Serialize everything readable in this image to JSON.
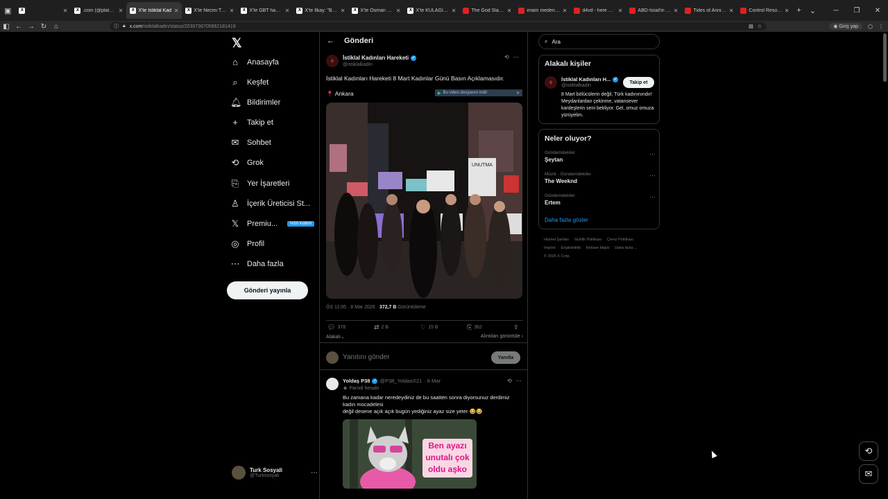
{
  "browser": {
    "tabs": [
      {
        "label": "",
        "icon": "x"
      },
      {
        "label": ".com (@platcon",
        "icon": "x"
      },
      {
        "label": "X'te İstiklal Kad",
        "icon": "x",
        "active": true
      },
      {
        "label": "X'te Necmi TAYIN: \"",
        "icon": "x"
      },
      {
        "label": "X'te GBT haberi: \"En",
        "icon": "x"
      },
      {
        "label": "X'te İlkay: \"Bu bisim",
        "icon": "x"
      },
      {
        "label": "X'te Osman Pamuk:",
        "icon": "x"
      },
      {
        "label": "X'te KULAĞI DELİK:",
        "icon": "x"
      },
      {
        "label": "The God Slayer - G",
        "icon": "yt"
      },
      {
        "label": "imam meden içerici",
        "icon": "yt"
      },
      {
        "label": "d4vd - here with m",
        "icon": "yt"
      },
      {
        "label": "ABD-İsrail'in Ortad",
        "icon": "yt"
      },
      {
        "label": "Tides of Annihilatio",
        "icon": "yt"
      },
      {
        "label": "Control Resonant",
        "icon": "yt"
      }
    ],
    "url_host": "x.com",
    "url_path": "/istiklalkadin/status/2030736705662181419",
    "signin_label": "Giriş yap"
  },
  "nav": {
    "logo": "𝕏",
    "items": [
      {
        "icon": "⌂",
        "label": "Anasayfa"
      },
      {
        "icon": "⌕",
        "label": "Keşfet"
      },
      {
        "icon": "🔔︎",
        "label": "Bildirimler"
      },
      {
        "icon": "+",
        "label": "Takip et"
      },
      {
        "icon": "✉",
        "label": "Sohbet"
      },
      {
        "icon": "⟲",
        "label": "Grok"
      },
      {
        "icon": "⎘",
        "label": "Yer İşaretleri"
      },
      {
        "icon": "♙",
        "label": "İçerik Üreticisi St..."
      },
      {
        "icon": "𝕏",
        "label": "Premiu..."
      },
      {
        "icon": "◎",
        "label": "Profil"
      },
      {
        "icon": "⋯",
        "label": "Daha fazla"
      }
    ],
    "premium_badge": "%50 indirim",
    "post_button": "Gönderi yayınla",
    "account": {
      "name": "Turk Sosyali",
      "handle": "@Turksosyali"
    }
  },
  "main": {
    "header_title": "Gönderi",
    "tweet": {
      "author": "İstiklal Kadınları Hareketi",
      "handle": "@istiklalkadin",
      "text": "İstiklal Kadınları Hareketi 8 Mart Kadınlar Günü Basın Açıklamasıdır.",
      "location": "Ankara",
      "video_note": "Bu video dosyasını indir",
      "image_caption": "UNUTMA",
      "time": "ÖS 11:05 · 8 Mar 2026 · ",
      "views": "372,7 B",
      "views_label": " Görüntüleme",
      "replies": "378",
      "reposts": "2 B",
      "likes": "15 B",
      "bookmarks": "362",
      "related_label": "Alakalı⌄",
      "quotes_label": "Alıntıları görüntüle ›"
    },
    "reply_box": {
      "placeholder": "Yanıtını gönder",
      "button": "Yanıtla"
    },
    "reply": {
      "author": "Yoldaş P38",
      "handle": "@P38_YoldasX21",
      "date": "· 8 Mar",
      "parody": "Parodi hesabı",
      "text_1": "Bu zamana kadar neredeydiniz de bu saatten sonra diyorsunuz derdimiz kadın mücadelesi",
      "text_2": "değil desene açık açık bugün yediğiniz ayaz size yeter 😂😂",
      "image_text": "Ben ayazı unutalı çok oldu aşko"
    }
  },
  "sidebar": {
    "search_placeholder": "Ara",
    "related_title": "Alakalı kişiler",
    "related_person": {
      "name": "İstiklal Kadınları H...",
      "handle": "@istiklalkadin",
      "follow": "Takip et",
      "bio": "8 Mart bölücülerin değil, Türk kadınınındır! Meydanlardan çekinme, vatansever kardeşlerin seni bekliyor. Gel, omuz omuza yürüyelim."
    },
    "trends_title": "Neler oluyor?",
    "trends": [
      {
        "context": "Gündemdekiler",
        "title": "Şeytan"
      },
      {
        "context": "Müzik · Gündemdekiler",
        "title": "The Weeknd"
      },
      {
        "context": "Gündemdekiler",
        "title": "Ertem"
      }
    ],
    "show_more": "Daha fazla göster",
    "footer": [
      "Hizmet Şartları",
      "Gizlilik Politikası",
      "Çerez Politikası",
      "İmprint",
      "Erişilebilirlik",
      "Reklam bilgisi",
      "Daha fazla ...",
      "© 2026 X Corp."
    ]
  }
}
